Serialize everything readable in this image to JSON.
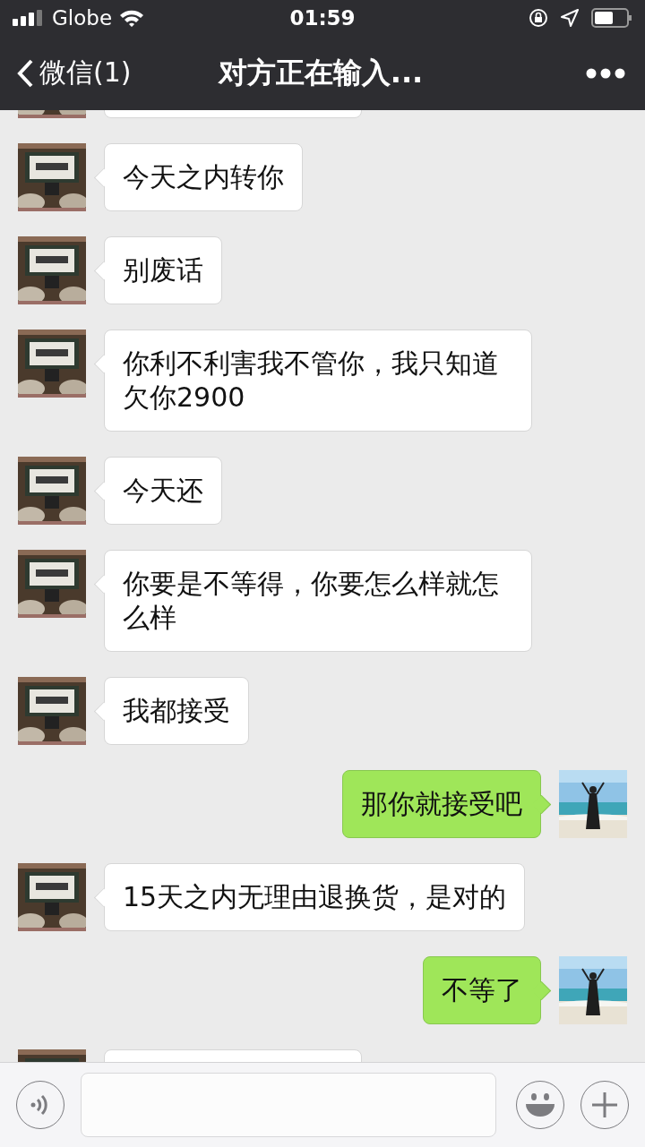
{
  "status_bar": {
    "carrier": "Globe",
    "time": "01:59"
  },
  "nav": {
    "back_label": "微信(1)",
    "title": "对方正在输入..."
  },
  "messages": [
    {
      "outgoing": false,
      "kind": "cut"
    },
    {
      "outgoing": false,
      "kind": "text",
      "text": "今天之内转你"
    },
    {
      "outgoing": false,
      "kind": "text",
      "text": "别废话"
    },
    {
      "outgoing": false,
      "kind": "text",
      "text": "你利不利害我不管你，我只知道欠你2900"
    },
    {
      "outgoing": false,
      "kind": "text",
      "text": "今天还"
    },
    {
      "outgoing": false,
      "kind": "text",
      "text": "你要是不等得，你要怎么样就怎么样"
    },
    {
      "outgoing": false,
      "kind": "text",
      "text": "我都接受"
    },
    {
      "outgoing": true,
      "kind": "text",
      "text": "那你就接受吧"
    },
    {
      "outgoing": false,
      "kind": "text",
      "text": "15天之内无理由退换货，是对的"
    },
    {
      "outgoing": true,
      "kind": "text",
      "text": "不等了"
    },
    {
      "outgoing": false,
      "kind": "cut"
    }
  ]
}
